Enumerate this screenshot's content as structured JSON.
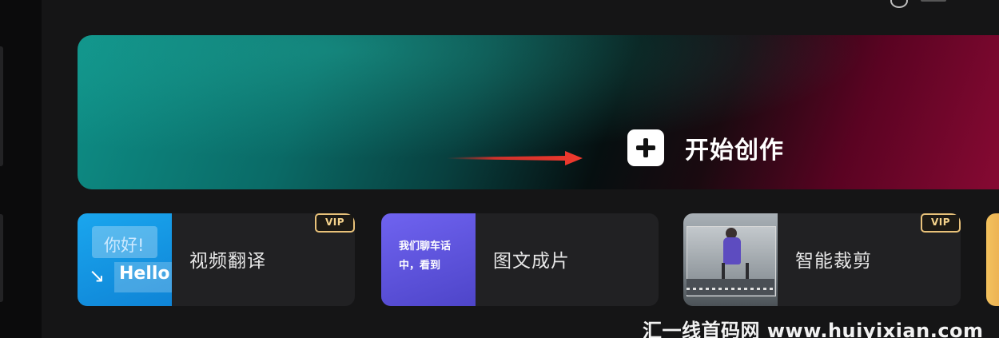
{
  "banner": {
    "create_label": "开始创作",
    "accent_start": "#0e8f87",
    "accent_end": "#8a0a34",
    "arrow_color": "#e5322b"
  },
  "cards": [
    {
      "title": "视频翻译",
      "vip": "VIP",
      "thumb": {
        "hello_cn": "你好!",
        "hello_en": "Hello",
        "arrow": "↘"
      }
    },
    {
      "title": "图文成片",
      "vip": "",
      "thumb": {
        "text": "我们聊车话中，看到"
      }
    },
    {
      "title": "智能裁剪",
      "vip": "VIP",
      "thumb": {}
    }
  ],
  "watermark": "汇一线首码网 www.huiyixian.com"
}
